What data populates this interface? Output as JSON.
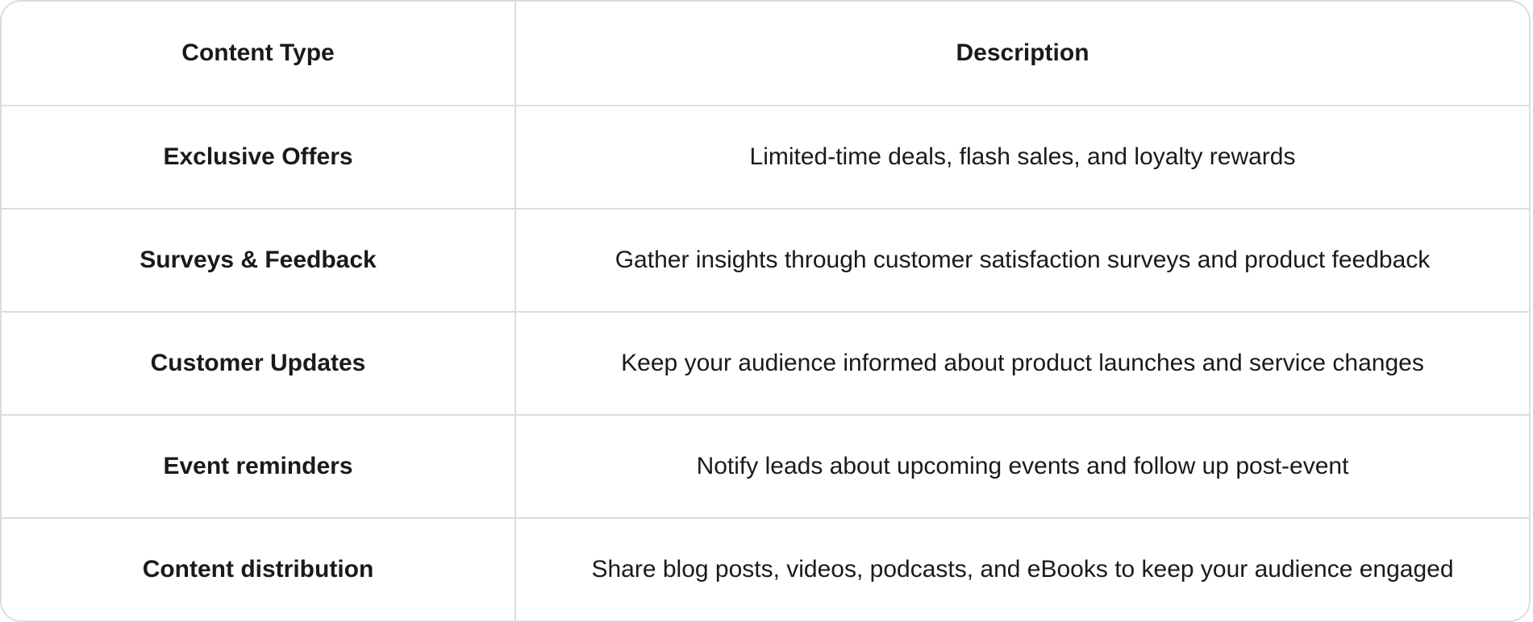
{
  "table": {
    "headers": {
      "col1": "Content Type",
      "col2": "Description"
    },
    "rows": [
      {
        "type": "Exclusive Offers",
        "description": "Limited-time deals, flash sales, and loyalty rewards"
      },
      {
        "type": "Surveys & Feedback",
        "description": "Gather insights through customer satisfaction surveys and product feedback"
      },
      {
        "type": "Customer Updates",
        "description": "Keep your audience informed about product launches and service changes"
      },
      {
        "type": "Event reminders",
        "description": "Notify leads about upcoming events and follow up post-event"
      },
      {
        "type": "Content distribution",
        "description": "Share blog posts, videos, podcasts, and eBooks to keep your audience engaged"
      }
    ]
  }
}
